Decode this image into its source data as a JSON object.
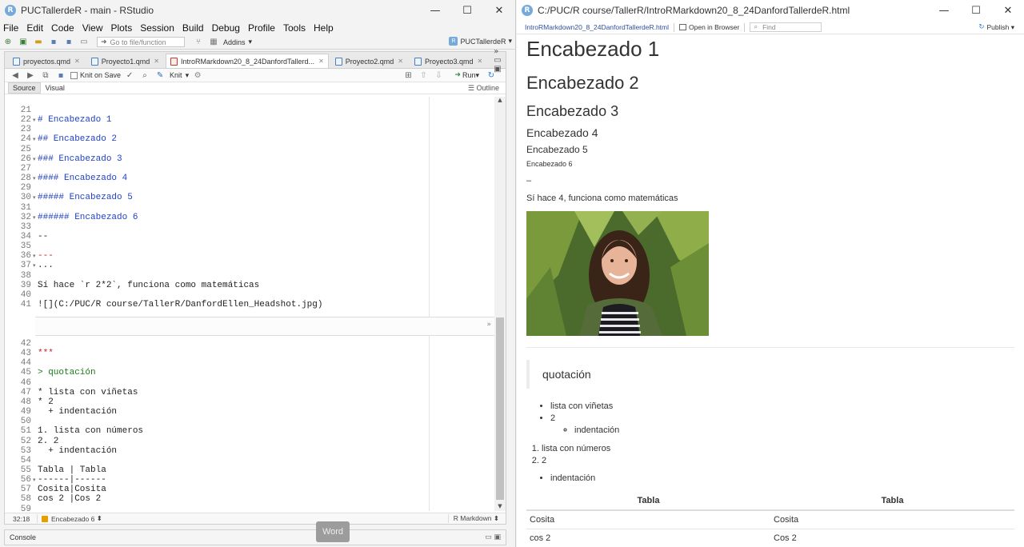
{
  "rstudio": {
    "title": "PUCTallerdeR - main - RStudio",
    "logo": "R",
    "window_controls": [
      "—",
      "☐",
      "✕"
    ],
    "menu": [
      "File",
      "Edit",
      "Code",
      "View",
      "Plots",
      "Session",
      "Build",
      "Debug",
      "Profile",
      "Tools",
      "Help"
    ],
    "toolbar": {
      "goto_placeholder": "Go to file/function",
      "addins": "Addins",
      "project": "PUCTallerdeR"
    },
    "tabs": [
      {
        "label": "proyectos.qmd"
      },
      {
        "label": "Proyecto1.qmd"
      },
      {
        "label": "IntroRMarkdown20_8_24DanfordTallerd..."
      },
      {
        "label": "Proyecto2.qmd"
      },
      {
        "label": "Proyecto3.qmd"
      }
    ],
    "editor_toolbar": {
      "knit_on_save": "Knit on Save",
      "knit": "Knit",
      "run": "Run"
    },
    "modes": {
      "source": "Source",
      "visual": "Visual",
      "outline": "Outline"
    },
    "code_top": [
      {
        "n": "21",
        "fold": "",
        "text": "",
        "cls": ""
      },
      {
        "n": "22",
        "fold": "▾",
        "text": "# Encabezado 1",
        "cls": "hdr"
      },
      {
        "n": "23",
        "fold": "",
        "text": "",
        "cls": ""
      },
      {
        "n": "24",
        "fold": "▾",
        "text": "## Encabezado 2",
        "cls": "hdr"
      },
      {
        "n": "25",
        "fold": "",
        "text": "",
        "cls": ""
      },
      {
        "n": "26",
        "fold": "▾",
        "text": "### Encabezado 3",
        "cls": "hdr"
      },
      {
        "n": "27",
        "fold": "",
        "text": "",
        "cls": ""
      },
      {
        "n": "28",
        "fold": "▾",
        "text": "#### Encabezado 4",
        "cls": "hdr"
      },
      {
        "n": "29",
        "fold": "",
        "text": "",
        "cls": ""
      },
      {
        "n": "30",
        "fold": "▾",
        "text": "##### Encabezado 5",
        "cls": "hdr"
      },
      {
        "n": "31",
        "fold": "",
        "text": "",
        "cls": ""
      },
      {
        "n": "32",
        "fold": "▾",
        "text": "###### Encabezado 6",
        "cls": "hdr"
      },
      {
        "n": "33",
        "fold": "",
        "text": "",
        "cls": ""
      },
      {
        "n": "34",
        "fold": "",
        "text": "--",
        "cls": ""
      },
      {
        "n": "35",
        "fold": "",
        "text": "",
        "cls": ""
      },
      {
        "n": "36",
        "fold": "▾",
        "text": "---",
        "cls": "red"
      },
      {
        "n": "37",
        "fold": "▾",
        "text": "...",
        "cls": ""
      },
      {
        "n": "38",
        "fold": "",
        "text": "",
        "cls": ""
      },
      {
        "n": "39",
        "fold": "",
        "text": "Sí hace `r 2*2`, funciona como matemáticas",
        "cls": ""
      },
      {
        "n": "40",
        "fold": "",
        "text": "",
        "cls": ""
      },
      {
        "n": "41",
        "fold": "",
        "text": "![](C:/PUC/R course/TallerR/DanfordEllen_Headshot.jpg)",
        "cls": ""
      }
    ],
    "code_bottom": [
      {
        "n": "42",
        "fold": "",
        "text": "",
        "cls": ""
      },
      {
        "n": "43",
        "fold": "",
        "text": "***",
        "cls": "red"
      },
      {
        "n": "44",
        "fold": "",
        "text": "",
        "cls": ""
      },
      {
        "n": "45",
        "fold": "",
        "text": "> quotación",
        "cls": "quote-c"
      },
      {
        "n": "46",
        "fold": "",
        "text": "",
        "cls": ""
      },
      {
        "n": "47",
        "fold": "",
        "text": "* lista con viñetas",
        "cls": ""
      },
      {
        "n": "48",
        "fold": "",
        "text": "* 2",
        "cls": ""
      },
      {
        "n": "49",
        "fold": "",
        "text": "  + indentación",
        "cls": ""
      },
      {
        "n": "50",
        "fold": "",
        "text": "",
        "cls": ""
      },
      {
        "n": "51",
        "fold": "",
        "text": "1. lista con números",
        "cls": ""
      },
      {
        "n": "52",
        "fold": "",
        "text": "2. 2",
        "cls": ""
      },
      {
        "n": "53",
        "fold": "",
        "text": "  + indentación",
        "cls": ""
      },
      {
        "n": "54",
        "fold": "",
        "text": "",
        "cls": ""
      },
      {
        "n": "55",
        "fold": "",
        "text": "Tabla | Tabla",
        "cls": ""
      },
      {
        "n": "56",
        "fold": "▾",
        "text": "------|------",
        "cls": ""
      },
      {
        "n": "57",
        "fold": "",
        "text": "Cosita|Cosita",
        "cls": ""
      },
      {
        "n": "58",
        "fold": "",
        "text": "cos 2 |Cos 2",
        "cls": ""
      },
      {
        "n": "59",
        "fold": "",
        "text": "",
        "cls": ""
      }
    ],
    "status": {
      "position": "32:18",
      "section": "Encabezado 6",
      "language": "R Markdown"
    },
    "console": "Console",
    "word_tip": "Word"
  },
  "viewer": {
    "title": "C:/PUC/R course/TallerR/IntroRMarkdown20_8_24DanfordTallerdeR.html",
    "file_link": "IntroRMarkdown20_8_24DanfordTallerdeR.html",
    "open_in_browser": "Open in Browser",
    "find_placeholder": "Find",
    "publish": "Publish",
    "doc": {
      "h1": "Encabezado 1",
      "h2": "Encabezado 2",
      "h3": "Encabezado 3",
      "h4": "Encabezado 4",
      "h5": "Encabezado 5",
      "h6": "Encabezado 6",
      "dash": "–",
      "para": "Sí hace 4, funciona como matemáticas",
      "blockquote": "quotación",
      "bullets": [
        "lista con viñetas",
        "2"
      ],
      "sub_bullet": "indentación",
      "numbered": [
        "lista con números",
        "2"
      ],
      "bullet2": "indentación",
      "table": {
        "headers": [
          "Tabla",
          "Tabla"
        ],
        "rows": [
          [
            "Cosita",
            "Cosita"
          ],
          [
            "cos 2",
            "Cos 2"
          ]
        ]
      }
    }
  }
}
